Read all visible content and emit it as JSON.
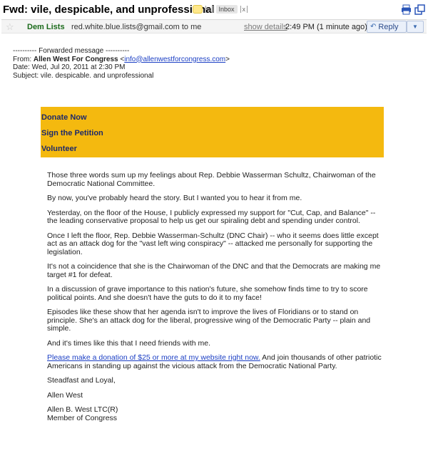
{
  "subject": {
    "title": "Fwd: vile, despicable, and unprofessional",
    "label_close": "x",
    "label_inbox": "Inbox",
    "label_inbox_close": "x"
  },
  "header": {
    "sender_name": "Dem Lists",
    "sender_email_to": "red.white.blue.lists@gmail.com to me",
    "show_details": "show details",
    "time": "2:49 PM (1 minute ago)",
    "reply": "Reply",
    "more": "▼"
  },
  "forwarded": {
    "divider": "---------- Forwarded message ----------",
    "from_label": "From: ",
    "from_name": "Allen West For Congress",
    "from_email_open": " <",
    "from_email": "info@allenwestforcongress.com",
    "from_email_close": ">",
    "date": "Date: Wed, Jul 20, 2011 at 2:30 PM",
    "subject": "Subject: vile. despicable. and unprofessional"
  },
  "links": {
    "donate": "Donate Now",
    "petition": "Sign the Petition",
    "volunteer": "Volunteer"
  },
  "letter": {
    "p1": "Those three words sum up my feelings about Rep. Debbie Wasserman Schultz, Chairwoman of the Democratic National Committee.",
    "p2": "By now, you've probably heard the story. But I wanted you to hear it from me.",
    "p3": "Yesterday, on the floor of the House, I publicly expressed my support for \"Cut, Cap, and Balance\" -- the leading conservative proposal to help us get our spiraling debt and spending under control.",
    "p4": "Once I left the floor, Rep. Debbie Wasserman-Schultz (DNC Chair) -- who it seems does little except act as an attack dog for the \"vast left wing conspiracy\" -- attacked me personally for supporting the legislation.",
    "p5": "It's not a coincidence that she is the Chairwoman of the DNC and that the Democrats are making me target #1 for defeat.",
    "p6": "In a discussion of grave importance to this nation's future, she somehow finds time to try to score political points. And she doesn't have the guts to do it to my face!",
    "p7": "Episodes like these show that her agenda isn't to improve the lives of Floridians or to stand on principle. She's an attack dog for the liberal, progressive wing of the Democratic Party -- plain and simple.",
    "p8": "And it's times like this that I need friends with me.",
    "p9_link": "Please make a donation of $25 or more at my website right now.",
    "p9_rest": " And join thousands of other patriotic Americans in standing up against the vicious attack from the Democratic National Party.",
    "closing": "Steadfast and Loyal,",
    "signature": "Allen West",
    "sig_name": "Allen B. West LTC(R)",
    "sig_title": "Member of Congress"
  }
}
